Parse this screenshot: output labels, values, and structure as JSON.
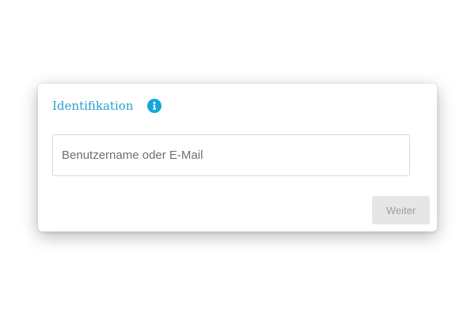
{
  "login_card": {
    "title": "Identifikation",
    "info_icon": "info-icon",
    "username_field": {
      "placeholder": "Benutzername oder E-Mail",
      "value": ""
    },
    "next_button_label": "Weiter",
    "next_button_state": "disabled"
  },
  "colors": {
    "accent": "#16a6dc",
    "title": "#2a9fd0",
    "button_disabled_bg": "#e6e6e6",
    "button_disabled_text": "#9d9d9d"
  }
}
